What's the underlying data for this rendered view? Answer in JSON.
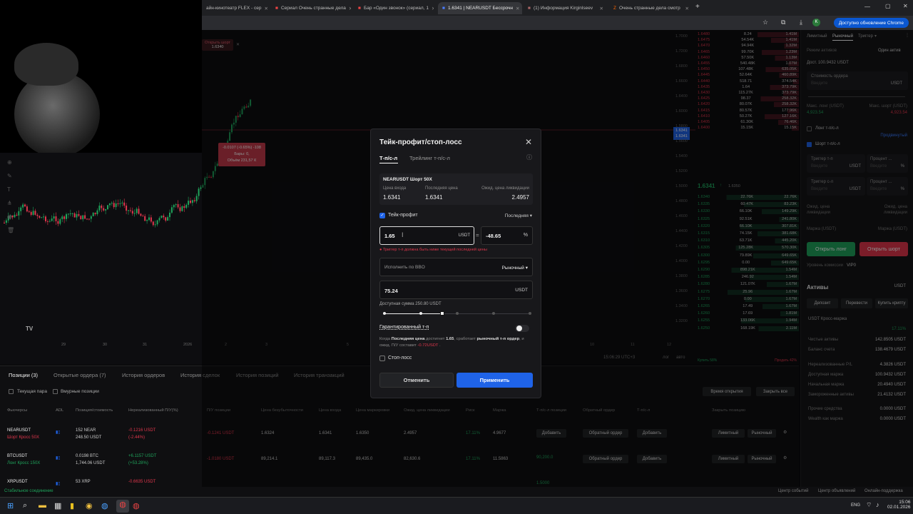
{
  "browser": {
    "tabs": [
      {
        "title": "айн-кинотеатр FLEX - сер"
      },
      {
        "title": "Сериал Очень странные дела"
      },
      {
        "title": "Бар «Один звонок» (сериал, 1"
      },
      {
        "title": "1.6341 | NEARUSDT Бессрочн"
      },
      {
        "title": "(1) Информация Kirginlseev"
      },
      {
        "title": "Очень странные дела смотр"
      }
    ],
    "update_button": "Доступно обновление Chrome",
    "new_tab": "+"
  },
  "chart": {
    "hover_label": "Открыть шорт",
    "hover_price": "1.6340",
    "tooltip": {
      "line1": "-0.0107 (-0.65%) -108",
      "line2": "Бары: 0,",
      "line3": "Объём 231,57 К"
    },
    "price_tag": "1.6341",
    "price_tag2": "1.6341",
    "x_labels": [
      "29",
      "30",
      "31",
      "2026",
      "2",
      "3",
      "5",
      "6",
      "10",
      "11",
      "12"
    ],
    "y_labels": [
      "1.7000",
      "1.7200",
      "1.6800",
      "1.6600",
      "1.6400",
      "1.6000",
      "1.5800",
      "1.5600",
      "1.5400",
      "1.5200",
      "1.5000",
      "1.4800",
      "1.4600",
      "1.4400",
      "1.4200",
      "1.4000",
      "1.3800",
      "1.3600",
      "1.3400",
      "1.3200"
    ],
    "time": "15:06:29 UTC+3",
    "mode1": "лог",
    "mode2": "авто",
    "logo": "TV"
  },
  "order_book": {
    "asks": [
      [
        "1.6480",
        "8.24",
        "1.41M"
      ],
      [
        "1.6475",
        "54.54K",
        "1.41M"
      ],
      [
        "1.6470",
        "94.94K",
        "1.32M"
      ],
      [
        "1.6465",
        "99.70K",
        "1.23M"
      ],
      [
        "1.6460",
        "57.50K",
        "1.13M"
      ],
      [
        "1.6455",
        "540.48K",
        "1.07M"
      ],
      [
        "1.6450",
        "107.48K",
        "635.05K"
      ],
      [
        "1.6445",
        "52.64K",
        "460.89K"
      ],
      [
        "1.6440",
        "518.71",
        "374.54K"
      ],
      [
        "1.6435",
        "1.64",
        "373.79K"
      ],
      [
        "1.6430",
        "115.27K",
        "373.79K"
      ],
      [
        "1.6425",
        "98.37",
        "258.32K"
      ],
      [
        "1.6420",
        "80.07K",
        "258.32K"
      ],
      [
        "1.6415",
        "80.57K",
        "177.96K"
      ],
      [
        "1.6410",
        "50.27K",
        "127.16K"
      ],
      [
        "1.6405",
        "61.30K",
        "76.46K"
      ],
      [
        "1.6400",
        "15.15K",
        "15.15K"
      ]
    ],
    "mid_price": "1.6341",
    "mid_sub": "1.6350",
    "bids": [
      [
        "1.6340",
        "22.76K",
        "22.76K"
      ],
      [
        "1.6335",
        "60.47K",
        "83.23K"
      ],
      [
        "1.6330",
        "66.10K",
        "149.29K"
      ],
      [
        "1.6325",
        "92.51K",
        "241.80K"
      ],
      [
        "1.6320",
        "66.10K",
        "307.81K"
      ],
      [
        "1.6315",
        "74.15K",
        "381.68K"
      ],
      [
        "1.6310",
        "63.71K",
        "445.20K"
      ],
      [
        "1.6305",
        "125.28K",
        "570.30K"
      ],
      [
        "1.6300",
        "79.89K",
        "649.65K"
      ],
      [
        "1.6295",
        "0.00",
        "649.65K"
      ],
      [
        "1.6290",
        "898.21K",
        "1.54M"
      ],
      [
        "1.6285",
        "246.92",
        "1.54M"
      ],
      [
        "1.6280",
        "121.07K",
        "1.67M"
      ],
      [
        "1.6275",
        "25.96",
        "1.67M"
      ],
      [
        "1.6270",
        "0.00",
        "1.67M"
      ],
      [
        "1.6265",
        "17.49",
        "1.67M"
      ],
      [
        "1.6260",
        "17.69",
        "1.81M"
      ],
      [
        "1.6255",
        "133.06K",
        "1.94M"
      ],
      [
        "1.6250",
        "168.19K",
        "2.11M"
      ]
    ],
    "buy_pct": "Купить 58%",
    "sell_pct": "Продать 42%"
  },
  "right_panel": {
    "tabs": [
      "Лимитный",
      "Рыночный",
      "Триггер"
    ],
    "mode_label": "Режим активов",
    "mode_value": "Один актив",
    "available": "Дост. 100.9432 USDT",
    "order_value_label": "Стоимость ордера",
    "order_value_ph": "Введите",
    "currency": "USDT",
    "max_long_label": "Макс. лонг (USDT)",
    "max_long_value": "4,923.54",
    "max_short_label": "Макс. шорт (USDT)",
    "max_short_value": "4,923.54",
    "long_tpsl": "Лонг т-п/с-л",
    "advanced": "Продвинутый",
    "short_tpsl": "Шорт т-п/с-л",
    "trigger_tp": "Триггер т-п",
    "trigger_sl": "Триггер с-л",
    "percent": "Процент ...",
    "enter": "Введите",
    "liq_label": "Ожид. цена ликвидации",
    "margin_label": "Маржа (USDT)",
    "margin_label2": "Маржа (USDT)",
    "open_long": "Открыть лонг",
    "open_short": "Открыть шорт",
    "fee_level_label": "Уровень комиссии",
    "fee_level_value": "VIP0",
    "assets_title": "Активы",
    "assets_currency": "USDT",
    "deposit": "Депозит",
    "transfer": "Перевести",
    "buy_crypto": "Купить крипту",
    "cross_margin": "USDT Кросс-маржа",
    "risk": "17.11%",
    "rows": [
      {
        "label": "Чистые активы",
        "value": "142.8505 USDT"
      },
      {
        "label": "Баланс счета",
        "value": "138.4679 USDT"
      },
      {
        "label": "Нереализованные P/L",
        "value": "4.3826 USDT"
      },
      {
        "label": "Доступная маржа",
        "value": "100.9432 USDT"
      },
      {
        "label": "Начальная маржа",
        "value": "20.4940 USDT"
      },
      {
        "label": "Замороженные активы",
        "value": "21.4132 USDT"
      },
      {
        "label": "Прочие средства",
        "value": "0.0000 USDT"
      },
      {
        "label": "Wealth как маржа",
        "value": "0.0000 USDT"
      }
    ]
  },
  "bottom": {
    "tabs": [
      "Позиции (3)",
      "Открытые ордера (7)",
      "История ордеров",
      "История сделок",
      "История позиций",
      "История транзакций"
    ],
    "filter1": "Текущая пара",
    "filter2": "Вмурные позиции",
    "sort": "Время открытия",
    "close_all": "Закрыть все",
    "headers": [
      "Фьючерсы",
      "ADL",
      "Позиция/стоимость",
      "Нереализованный П/У(%)",
      "П/У позиции",
      "Цена безубыточности",
      "Цена входа",
      "Цена маркировки",
      "Ожид. цена ликвидации",
      "Риск",
      "Маржа",
      "Т-п/с-л позиции",
      "Обратный ордер",
      "Т-п/с-л",
      "Закрыть позицию"
    ],
    "positions": [
      {
        "symbol": "NEARUSDT",
        "sub": "Шорт Кросс 50X",
        "pos": "152 NEAR",
        "pos2": "248.50 USDT",
        "upnl": "-0.1216 USDT",
        "upnl2": "(-2.44%)",
        "pnl": "-0.1241 USDT",
        "be": "1.6324",
        "entry": "1.6341",
        "mark": "1.6350",
        "liq": "2.4957",
        "risk": "17.11%",
        "margin": "4.9677",
        "tpsl": "Добавить",
        "reverse": "Обратный ордер",
        "tpsl2": "Добавить",
        "limit": "Лимитный",
        "market": "Рыночный"
      },
      {
        "symbol": "BTCUSDT",
        "sub": "Лонг Кросс 150X",
        "pos": "0.0198 BTC",
        "pos2": "1,744.06 USDT",
        "upnl": "+6.1157 USDT",
        "upnl2": "(+53.28%)",
        "pnl": "-1.0180 USDT",
        "be": "89,214.1",
        "entry": "89,117.3",
        "mark": "89,435.0",
        "liq": "82,630.6",
        "risk": "17.11%",
        "margin": "11.5863",
        "tpsl": "90,200.0",
        "reverse": "Обратный ордер",
        "tpsl2": "Добавить",
        "limit": "Лимитный",
        "market": "Рыночный"
      },
      {
        "symbol": "XRPUSDT",
        "sub": "",
        "pos": "53 XRP",
        "pos2": "",
        "upnl": "-0.6635 USDT",
        "upnl2": "",
        "pnl": "",
        "be": "",
        "entry": "",
        "mark": "",
        "liq": "",
        "risk": "",
        "margin": "",
        "tpsl": "1.5000",
        "reverse": "",
        "tpsl2": "",
        "limit": "",
        "market": ""
      }
    ]
  },
  "status": {
    "connection": "Стабильное соединение",
    "events": "Центр событий",
    "ads": "Центр объявлений",
    "support": "Онлайн-поддержка"
  },
  "taskbar": {
    "lang": "ENG",
    "time": "15:06",
    "date": "02.01.2026"
  },
  "modal": {
    "title": "Тейк-профит/стоп-лосс",
    "tab_active": "Т-п/с-л",
    "tab_other": "Трейлинг т-п/с-л",
    "contract": "NEARUSDT Шорт 50X",
    "entry_label": "Цена входа",
    "entry_value": "1.6341",
    "last_label": "Последняя цена",
    "last_value": "1.6341",
    "liq_label": "Ожид. цена ликвидации",
    "liq_value": "2.4957",
    "tp_label": "Тейк-профит",
    "price_type": "Последняя",
    "tp_value": "1.65",
    "tp_unit": "USDT",
    "eq": "=",
    "pct_value": "-48.65",
    "pct_unit": "%",
    "error": "Триггер т-п должна быть ниже текущей последней цены",
    "exec_label": "Исполнить по BBO",
    "exec_value": "Рыночный",
    "qty_value": "75.24",
    "qty_unit": "USDT",
    "available": "Доступная сумма 250.80 USDT",
    "slider_pct": 0.4,
    "guaranteed_label": "Гарантированный т-п",
    "hint_a": "Когда ",
    "hint_b": "Последняя цена",
    "hint_c": " достигнет ",
    "hint_d": "1.65",
    "hint_e": ", сработает ",
    "hint_f": "рыночный т-п ордер",
    "hint_g": ", и ожид. П/У составит ",
    "hint_h": "-0.72USDT",
    "hint_i": " .",
    "sl_label": "Стоп-лосс",
    "cancel": "Отменить",
    "apply": "Применить"
  },
  "colors": {
    "accent": "#1f63e8",
    "up": "#1fa35b",
    "down": "#e0364c",
    "text": "#d6d6d6"
  }
}
